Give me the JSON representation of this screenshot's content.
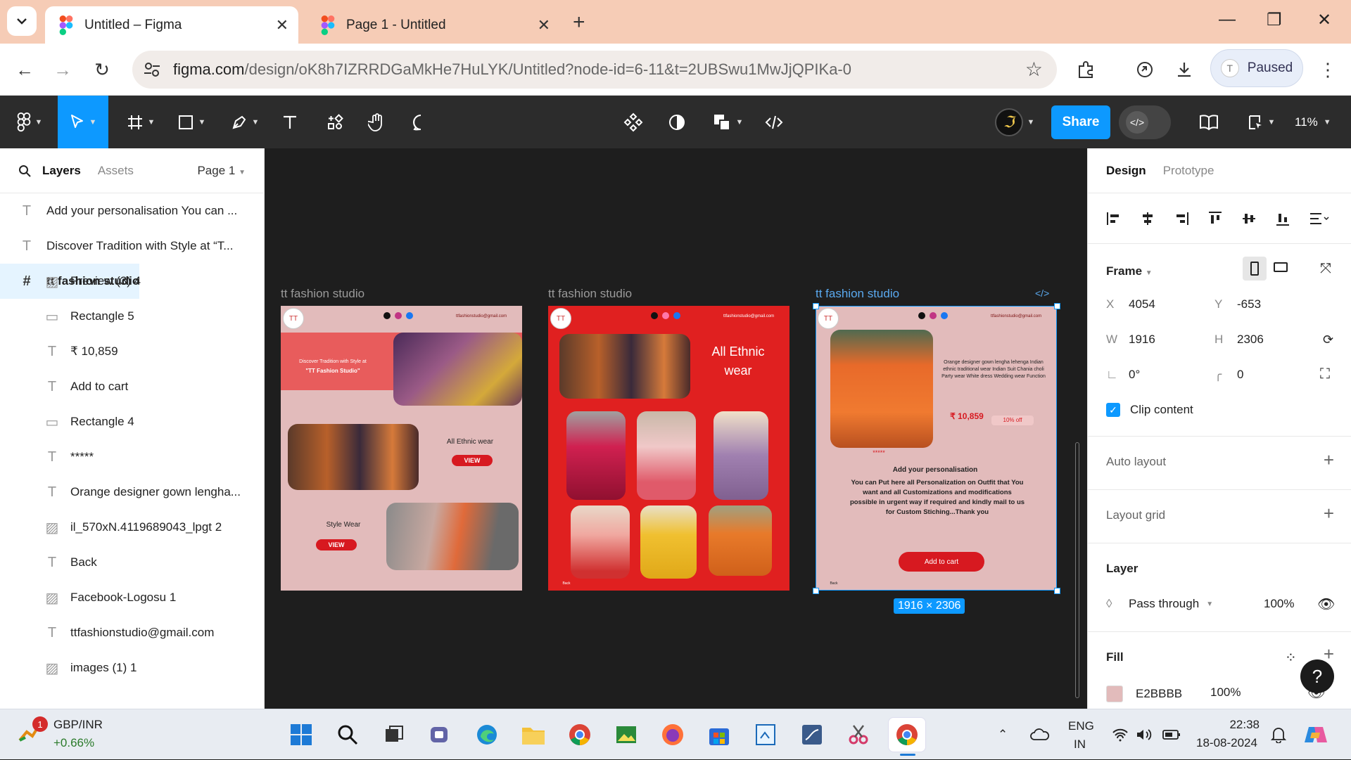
{
  "browser": {
    "tabs": [
      {
        "title": "Untitled – Figma",
        "active": true
      },
      {
        "title": "Page 1 - Untitled",
        "active": false
      }
    ],
    "url_host": "figma.com",
    "url_path": "/design/oK8h7IZRRDGaMkHe7HuLYK/Untitled?node-id=6-11&t=2UBSwu1MwJjQPIKa-0",
    "profile_initial": "T",
    "profile_status": "Paused"
  },
  "toolbar": {
    "share_label": "Share",
    "zoom": "11%"
  },
  "left_panel": {
    "tab_layers": "Layers",
    "tab_assets": "Assets",
    "page_selector": "Page 1",
    "top_layers": [
      {
        "icon": "text",
        "name": "Add your personalisation  You can ..."
      },
      {
        "icon": "text",
        "name": "Discover Tradition with Style at “T..."
      },
      {
        "icon": "frame",
        "name": "tt fashion studio"
      }
    ],
    "child_layers": [
      {
        "icon": "image",
        "name": "Preview (3) 4"
      },
      {
        "icon": "rect",
        "name": "Rectangle 5"
      },
      {
        "icon": "text",
        "name": "₹ 10,859"
      },
      {
        "icon": "text",
        "name": "Add to cart"
      },
      {
        "icon": "rect",
        "name": "Rectangle 4"
      },
      {
        "icon": "text",
        "name": "*****"
      },
      {
        "icon": "text",
        "name": "Orange designer gown lengha..."
      },
      {
        "icon": "image",
        "name": "il_570xN.4119689043_lpgt 2"
      },
      {
        "icon": "text",
        "name": "Back"
      },
      {
        "icon": "image",
        "name": "Facebook-Logosu 1"
      },
      {
        "icon": "text",
        "name": "ttfashionstudio@gmail.com"
      },
      {
        "icon": "image",
        "name": "images (1) 1"
      }
    ]
  },
  "canvas": {
    "frame_label": "tt fashion studio",
    "email": "ttfashionstudio@gmail.com",
    "logo": "TT",
    "frame1": {
      "hero_text_1": "Discover Tradition with Style at",
      "hero_text_2": "\"TT Fashion Studio\"",
      "ethnic": "All Ethnic wear",
      "view": "VIEW",
      "style": "Style Wear"
    },
    "frame2": {
      "title_line1": "All Ethnic",
      "title_line2": "wear",
      "back": "Back"
    },
    "frame3": {
      "desc": "Orange designer gown lengha lehenga Indian ethnic traditional wear Indian Suit Chania choli Party wear White dress Wedding wear Function",
      "price": "₹ 10,859",
      "discount": "10% off",
      "stars": "*****",
      "person_title": "Add your personalisation",
      "person_body": "You can Put here all Personalization on Outfit that You want and all Customizations and modifications possible in urgent way if required and kindly mail to us for Custom Stiching...Thank you",
      "add_to_cart": "Add to cart",
      "back": "Back"
    },
    "selection_size": "1916 × 2306"
  },
  "right_panel": {
    "tab_design": "Design",
    "tab_prototype": "Prototype",
    "frame_label": "Frame",
    "x": "4054",
    "y": "-653",
    "w": "1916",
    "h": "2306",
    "rotation": "0°",
    "radius": "0",
    "clip_content": "Clip content",
    "auto_layout": "Auto layout",
    "layout_grid": "Layout grid",
    "layer_title": "Layer",
    "blend_mode": "Pass through",
    "opacity": "100%",
    "fill_title": "Fill",
    "fill_hex": "E2BBBB",
    "fill_opacity": "100%",
    "fill_color": "#e2bbbb"
  },
  "taskbar": {
    "stock_name": "GBP/INR",
    "stock_change": "+0.66%",
    "notif_count": "1",
    "lang_1": "ENG",
    "lang_2": "IN",
    "time": "22:38",
    "date": "18-08-2024"
  }
}
